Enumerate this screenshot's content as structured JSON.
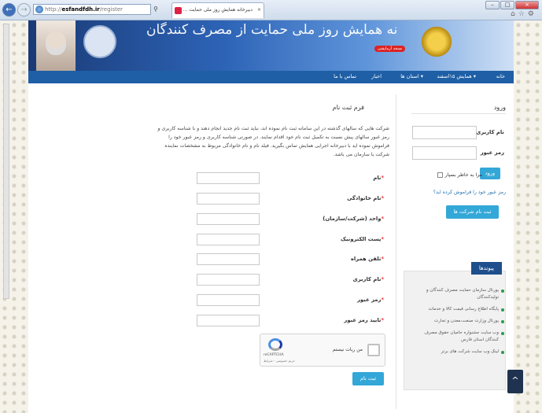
{
  "browser": {
    "address": {
      "prefix": "http://",
      "host": "esfandfdh.ir",
      "path": "/register"
    },
    "search_icon": "search-icon",
    "tab_title": "دبیرخانه همایش روز ملی حمایت ...",
    "tab_close": "×",
    "window_controls": {
      "minimize": "–",
      "maximize": "□",
      "close": "×"
    }
  },
  "banner": {
    "title": "دبیرخانه همایش روز ملی حمایت از مصرف کنندگان",
    "badge": "نسخه آزمایشی"
  },
  "nav": {
    "home": "خانه",
    "summit": "همایش ۱۵اسفند ▾",
    "provinces": "استان ها ▾",
    "news": "اخبار",
    "contact": "تماس با ما"
  },
  "register": {
    "title": "فرم ثبت نام",
    "intro": "شرکت هایی که سالهای گذشته در این سامانه ثبت نام نموده اند، نباید ثبت نام جدید انجام دهند و با شناسه کاربری و رمز عبور سالهای پیش نسبت به تکمیل ثبت نام خود اقدام نمایند. در صورتی شناسه کاربری و رمز عبور خود را فراموش نموده اید با دبیرخانه اجرایی همایش تماس بگیرید. فیلد نام و نام خانوادگی مربوط به مشخصات نماینده شرکت یا سازمان می باشد.",
    "fields": [
      {
        "label": "نام",
        "required_mark": "*"
      },
      {
        "label": "نام خانوادگی",
        "required_mark": "*"
      },
      {
        "label": "واحد (شرکت/سازمان)",
        "required_mark": "*"
      },
      {
        "label": "پست الکترونیک",
        "required_mark": "*"
      },
      {
        "label": "تلفن همراه",
        "required_mark": "*"
      },
      {
        "label": "نام کاربری",
        "required_mark": "*"
      },
      {
        "label": "رمز عبور",
        "required_mark": "*"
      },
      {
        "label": "تایید رمز عبور",
        "required_mark": "*"
      }
    ],
    "captcha": {
      "label": "من ربات نیستم",
      "brand": "reCAPTCHA",
      "terms": "حریم خصوصی - شرایط"
    },
    "submit": "ثبت نام"
  },
  "login": {
    "title": "ورود",
    "username_label": "نام کاربری",
    "password_label": "رمز عبور",
    "submit": "ورود",
    "remember": "مرا به خاطر بسپار",
    "forgot": "رمز عبور خود را فراموش کرده اید؟",
    "company_register": "ثبت نام شرکت ها"
  },
  "links": {
    "title": "پیوندها",
    "items": [
      "پورتال سازمان حمایت مصرف کنندگان و تولیدکنندگان",
      "پایگاه اطلاع رسانی قیمت کالا و خدمات",
      "پورتال وزارت صنعت،معدن و تجارت",
      "وب سایت جشنواره حامیان حقوق مصرف کنندگان استان فارس",
      "لینک وب سایت شرکت های برتر"
    ]
  },
  "to_top": "^"
}
